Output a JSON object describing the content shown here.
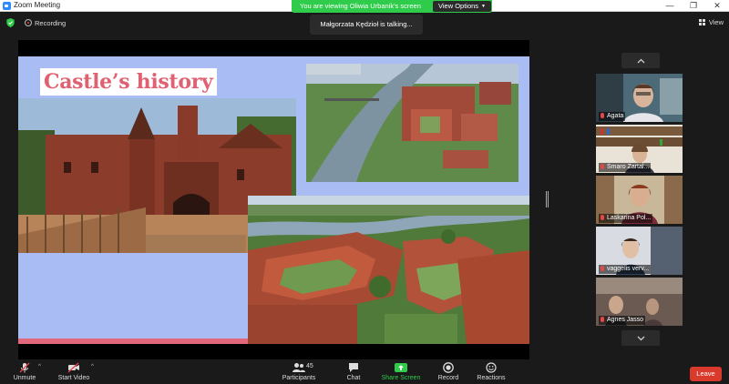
{
  "window": {
    "title": "Zoom Meeting",
    "minimize": "—",
    "maximize": "❐",
    "close": "✕"
  },
  "banner": {
    "text": "You are viewing Oliwia Urbanik's screen",
    "view_options": "View Options",
    "caret": "▼"
  },
  "status": {
    "recording_label": "Recording",
    "talking": "Małgorzata Kędzioł is talking...",
    "view_label": "View"
  },
  "slide": {
    "title": "Castle’s history"
  },
  "gallery": {
    "up_icon": "chevron-up-icon",
    "down_icon": "chevron-down-icon",
    "participants": [
      {
        "name": "Agata"
      },
      {
        "name": "Smaro Zartal..."
      },
      {
        "name": "Laskarina Pol..."
      },
      {
        "name": "vaggelis verv..."
      },
      {
        "name": "Agnes Jasso"
      }
    ]
  },
  "toolbar": {
    "unmute": "Unmute",
    "start_video": "Start Video",
    "participants": "Participants",
    "participants_count": "45",
    "chat": "Chat",
    "share_screen": "Share Screen",
    "record": "Record",
    "reactions": "Reactions",
    "leave": "Leave",
    "caret": "^"
  },
  "colors": {
    "accent_green": "#2ecc4a",
    "leave_red": "#d93a2c",
    "slide_bg": "#a9bdf4",
    "title_pink": "#df6172"
  }
}
